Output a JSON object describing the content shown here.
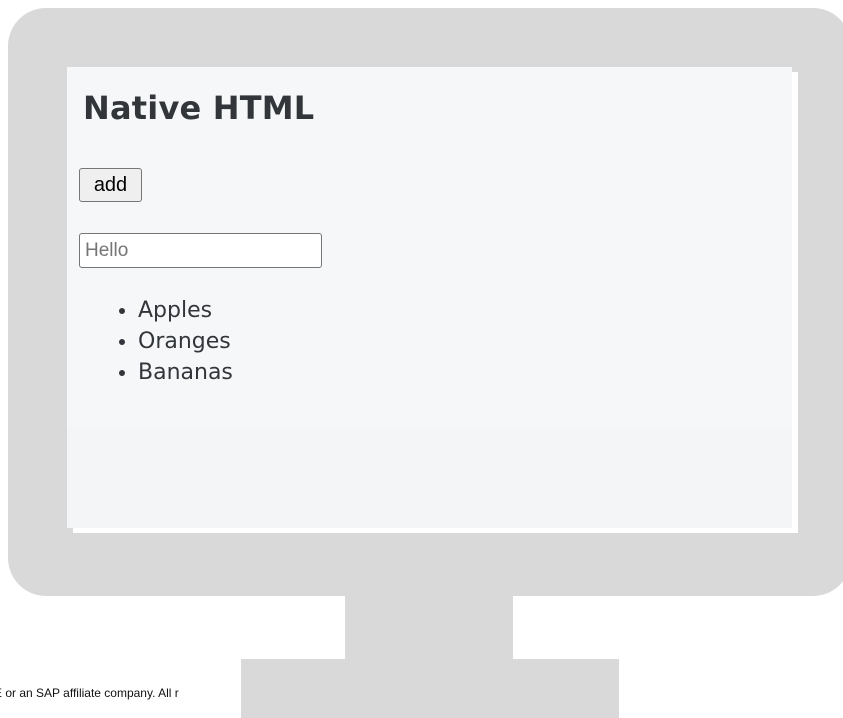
{
  "page": {
    "title": "Native HTML"
  },
  "controls": {
    "add_button_label": "add",
    "input_placeholder": "Hello",
    "input_value": ""
  },
  "list": {
    "items": [
      "Apples",
      "Oranges",
      "Bananas"
    ]
  },
  "footer": {
    "copyright_fragment": "E or an SAP affiliate company. All r"
  },
  "colors": {
    "bezel": "#d9d9d9",
    "screen_background": "#f6f7f8",
    "text": "#32363a"
  }
}
